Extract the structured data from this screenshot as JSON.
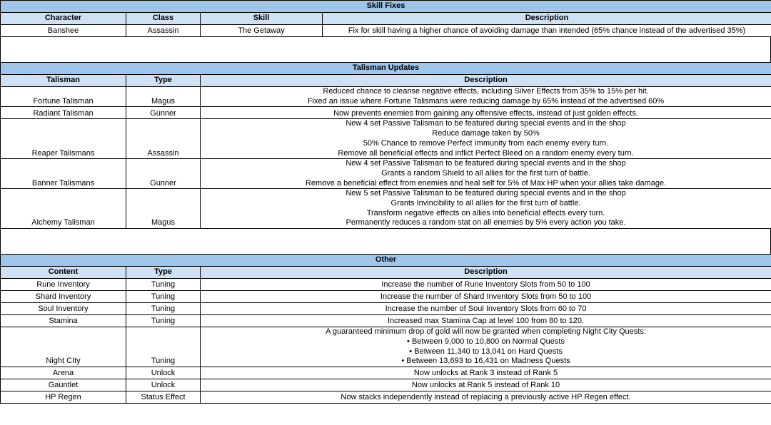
{
  "skill_fixes": {
    "title": "Skill Fixes",
    "headers": [
      "Character",
      "Class",
      "Skill",
      "Description"
    ],
    "rows": [
      {
        "character": "Banshee",
        "class": "Assassin",
        "skill": "The Getaway",
        "description": [
          "Fix for skill having a higher chance of avoiding damage than intended (65% chance instead of the advertised 35%)"
        ]
      }
    ]
  },
  "talisman_updates": {
    "title": "Talisman Updates",
    "headers": [
      "Talisman",
      "Type",
      "Description"
    ],
    "rows": [
      {
        "talisman": "Fortune Talisman",
        "type": "Magus",
        "description": [
          "Reduced chance to cleanse negative effects, including Silver Effects from 35% to 15% per hit.",
          "Fixed an issue where Fortune Talismans were reducing damage by 65% instead of the advertised 60%"
        ]
      },
      {
        "talisman": "Radiant Talisman",
        "type": "Gunner",
        "description": [
          "Now prevents enemies from gaining any offensive effects, instead of just golden effects."
        ]
      },
      {
        "talisman": "Reaper Talismans",
        "type": "Assassin",
        "description": [
          "New 4 set Passive Talisman to be featured during special events and in the shop",
          "Reduce damage taken by 50%",
          "50% Chance to remove Perfect Immunity from each enemy every turn.",
          "Remove all beneficial effects and inflict Perfect Bleed on a random enemy every turn."
        ]
      },
      {
        "talisman": "Banner Talismans",
        "type": "Gunner",
        "description": [
          "New 4 set Passive Talisman to be featured during special events and in the shop",
          "Grants a random Shield to all allies for the first turn of battle.",
          "Remove a beneficial effect from enemies and heal self for 5% of Max HP when your allies take damage."
        ]
      },
      {
        "talisman": "Alchemy Talisman",
        "type": "Magus",
        "description": [
          "New 5 set Passive Talisman to be featured during special events and in the shop",
          "Grants Invincibility to all allies for the first turn of battle.",
          "Transform negative effects on allies into beneficial effects every turn.",
          "Permanently reduces a random stat on all enemies by 5% every action you take."
        ]
      }
    ]
  },
  "other": {
    "title": "Other",
    "headers": [
      "Content",
      "Type",
      "Description"
    ],
    "rows": [
      {
        "content": "Rune Inventory",
        "type": "Tuning",
        "description": [
          "Increase the number of Rune Inventory Slots from 50 to 100"
        ]
      },
      {
        "content": "Shard Inventory",
        "type": "Tuning",
        "description": [
          "Increase the number of Shard Inventory Slots from 50 to 100"
        ]
      },
      {
        "content": "Soul Inventory",
        "type": "Tuning",
        "description": [
          "Increase the number of Soul Inventory Slots from 60 to 70"
        ]
      },
      {
        "content": "Stamina",
        "type": "Tuning",
        "description": [
          "Increased max Stamina Cap at level 100 from 80 to 120."
        ]
      },
      {
        "content": "Night CIty",
        "type": "Tuning",
        "description": [
          "A guaranteed minimum drop of gold will now be granted when completing Night City Quests:",
          "• Between 9,000 to 10,800 on Normal Quests",
          "• Between 11,340 to 13,041 on Hard Quests",
          "• Between 13,693 to 16,431 on Madness Quests"
        ]
      },
      {
        "content": "Arena",
        "type": "Unlock",
        "description": [
          "Now unlocks at Rank 3 instead of Rank 5"
        ]
      },
      {
        "content": "Gauntlet",
        "type": "Unlock",
        "description": [
          "Now unlocks at Rank 5 instead of Rank 10"
        ]
      },
      {
        "content": "HP Regen",
        "type": "Status Effect",
        "description": [
          "Now stacks independently instead of replacing a previously active HP Regen effect."
        ]
      }
    ]
  }
}
